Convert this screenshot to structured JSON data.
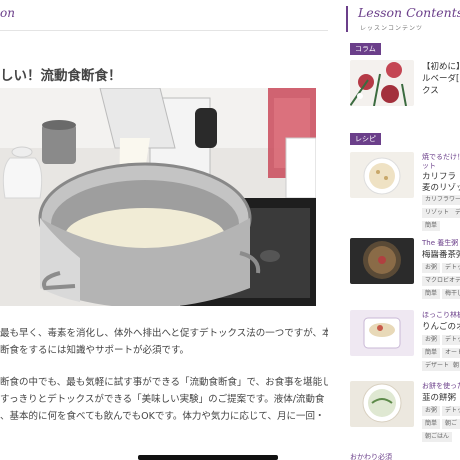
{
  "main": {
    "section_label": "on",
    "article_title": "しい！流動食断食！",
    "paragraphs": [
      [
        "最も早く、毒素を消化し、体外へ排出へと促すデトックス法の一つですが、本",
        "断食をするには知識やサポートが必須です。"
      ],
      [
        "断食の中でも、最も気軽に試す事ができる「流動食断食」で、お食事を堪能し",
        "すっきりとデトックスができる「美味しい実験」のご提案です。液体/流動食",
        "、基本的に何を食べても飲んでもOKです。体力や気力に応じて、月に一回・"
      ]
    ]
  },
  "sidebar": {
    "title": "Lesson Contents",
    "subtitle": "レッスンコンテンツ",
    "column_badge": "コラム",
    "recipe_badge": "レシピ",
    "column_card": {
      "line1": "【初めに】",
      "line2": "ルベーダ[",
      "line3": "クス"
    },
    "recipe_cards": [
      {
        "title": "焼でるだけ！",
        "title2": "ット",
        "heading1": "カリフラ",
        "heading2": "麦のリゾッ",
        "tags": [
          "カリフラワー",
          "リゾット",
          "デト",
          "簡単"
        ]
      },
      {
        "title": "The 養生粥",
        "heading1": "梅醤番茶粥",
        "tags": [
          "お粥",
          "デトック",
          "マクロビオティ",
          "簡単",
          "梅干し"
        ]
      },
      {
        "title": "ほっこり林檎",
        "heading1": "りんごのオ",
        "tags": [
          "お粥",
          "デトッ",
          "簡単",
          "オート",
          "デザート",
          "朝"
        ]
      },
      {
        "title": "お餅を使った",
        "heading1": "韮の餅粥",
        "tags": [
          "お粥",
          "デトック",
          "簡単",
          "朝ご",
          "朝ごはん"
        ]
      }
    ],
    "next_title": "おかわり必須"
  }
}
